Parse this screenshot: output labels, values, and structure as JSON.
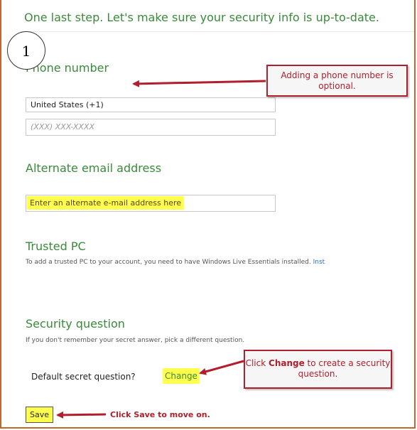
{
  "header": {
    "headline": "One last step. Let's make sure your security info is up-to-date."
  },
  "annotation": {
    "step_number": "1"
  },
  "phone": {
    "heading": "Phone number",
    "country_select": "United States (+1)",
    "number_placeholder": "(XXX) XXX-XXXX"
  },
  "email": {
    "heading": "Alternate email address",
    "value": "Enter an alternate e-mail address here"
  },
  "trusted_pc": {
    "heading": "Trusted PC",
    "text": "To add a trusted PC to your account, you need to have Windows Live Essentials installed.",
    "link": "Inst"
  },
  "security_question": {
    "heading": "Security question",
    "text": "If you don't remember your secret answer, pick a different question.",
    "label": "Default secret question?",
    "change_link": "Change"
  },
  "save": {
    "label": "Save"
  },
  "callouts": {
    "phone_optional": "Adding a phone number is optional.",
    "change_prefix": "Click ",
    "change_bold": "Change",
    "change_suffix": " to create a security question.",
    "save_note": "Click Save to move on."
  },
  "colors": {
    "accent_green": "#3a8a3a",
    "callout_red": "#b01f2b",
    "highlight_yellow": "#ffff4d",
    "frame_orange": "#c0692e",
    "link_blue": "#1f6fc8"
  }
}
